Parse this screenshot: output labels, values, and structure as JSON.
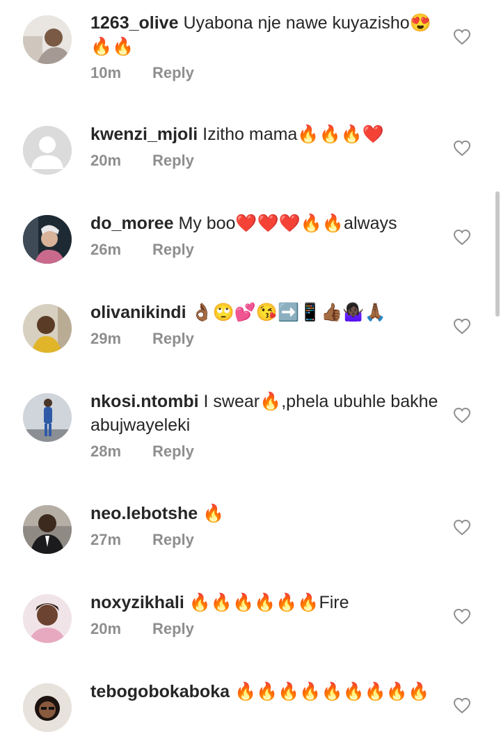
{
  "comments": [
    {
      "username": "1263_olive",
      "text": "Uyabona nje nawe kuyazisho😍🔥🔥",
      "time": "10m",
      "reply": "Reply",
      "avatar": "user-photo"
    },
    {
      "username": "kwenzi_mjoli",
      "text": "Izitho mama🔥🔥🔥❤️",
      "time": "20m",
      "reply": "Reply",
      "avatar": "default-avatar"
    },
    {
      "username": "do_moree",
      "text": "My boo❤️❤️❤️🔥🔥always",
      "time": "26m",
      "reply": "Reply",
      "avatar": "user-photo"
    },
    {
      "username": "olivanikindi",
      "text": "👌🏾🙄💕😘➡️📱👍🏾🤷🏿‍♀️🙏🏾",
      "time": "29m",
      "reply": "Reply",
      "avatar": "user-photo"
    },
    {
      "username": "nkosi.ntombi",
      "text": "I swear🔥,phela ubuhle bakhe abujwayeleki",
      "time": "28m",
      "reply": "Reply",
      "avatar": "user-photo"
    },
    {
      "username": "neo.lebotshe",
      "text": "🔥",
      "time": "27m",
      "reply": "Reply",
      "avatar": "user-photo"
    },
    {
      "username": "noxyzikhali",
      "text": "🔥🔥🔥🔥🔥🔥Fire",
      "time": "20m",
      "reply": "Reply",
      "avatar": "user-photo"
    },
    {
      "username": "tebogobokaboka",
      "text": "🔥🔥🔥🔥🔥🔥🔥🔥🔥",
      "time": "",
      "reply": "",
      "avatar": "user-photo"
    }
  ],
  "icons": {
    "like": "heart-outline-icon"
  },
  "colors": {
    "text": "#262626",
    "meta": "#8e8e8e",
    "heart_stroke": "#8e8e8e",
    "background": "#ffffff"
  }
}
